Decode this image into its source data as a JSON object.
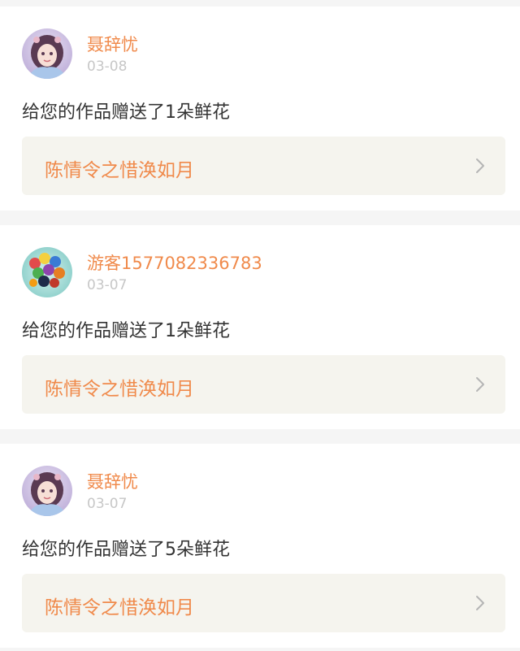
{
  "notifications": [
    {
      "user": "聂辞忧",
      "date": "03-08",
      "message": "给您的作品赠送了1朵鲜花",
      "work_title": "陈情令之惜涣如月",
      "avatar": "anime-girl-avatar"
    },
    {
      "user": "游客1577082336783",
      "date": "03-07",
      "message": "给您的作品赠送了1朵鲜花",
      "work_title": "陈情令之惜涣如月",
      "avatar": "balloons-avatar"
    },
    {
      "user": "聂辞忧",
      "date": "03-07",
      "message": "给您的作品赠送了5朵鲜花",
      "work_title": "陈情令之惜涣如月",
      "avatar": "anime-girl-avatar"
    }
  ],
  "colors": {
    "accent": "#f08a4b",
    "text": "#333333",
    "muted": "#c7c7c7",
    "link_bg": "#f5f4ee",
    "page_bg": "#f5f5f5"
  },
  "icons": {
    "chevron": "chevron-right-icon"
  }
}
